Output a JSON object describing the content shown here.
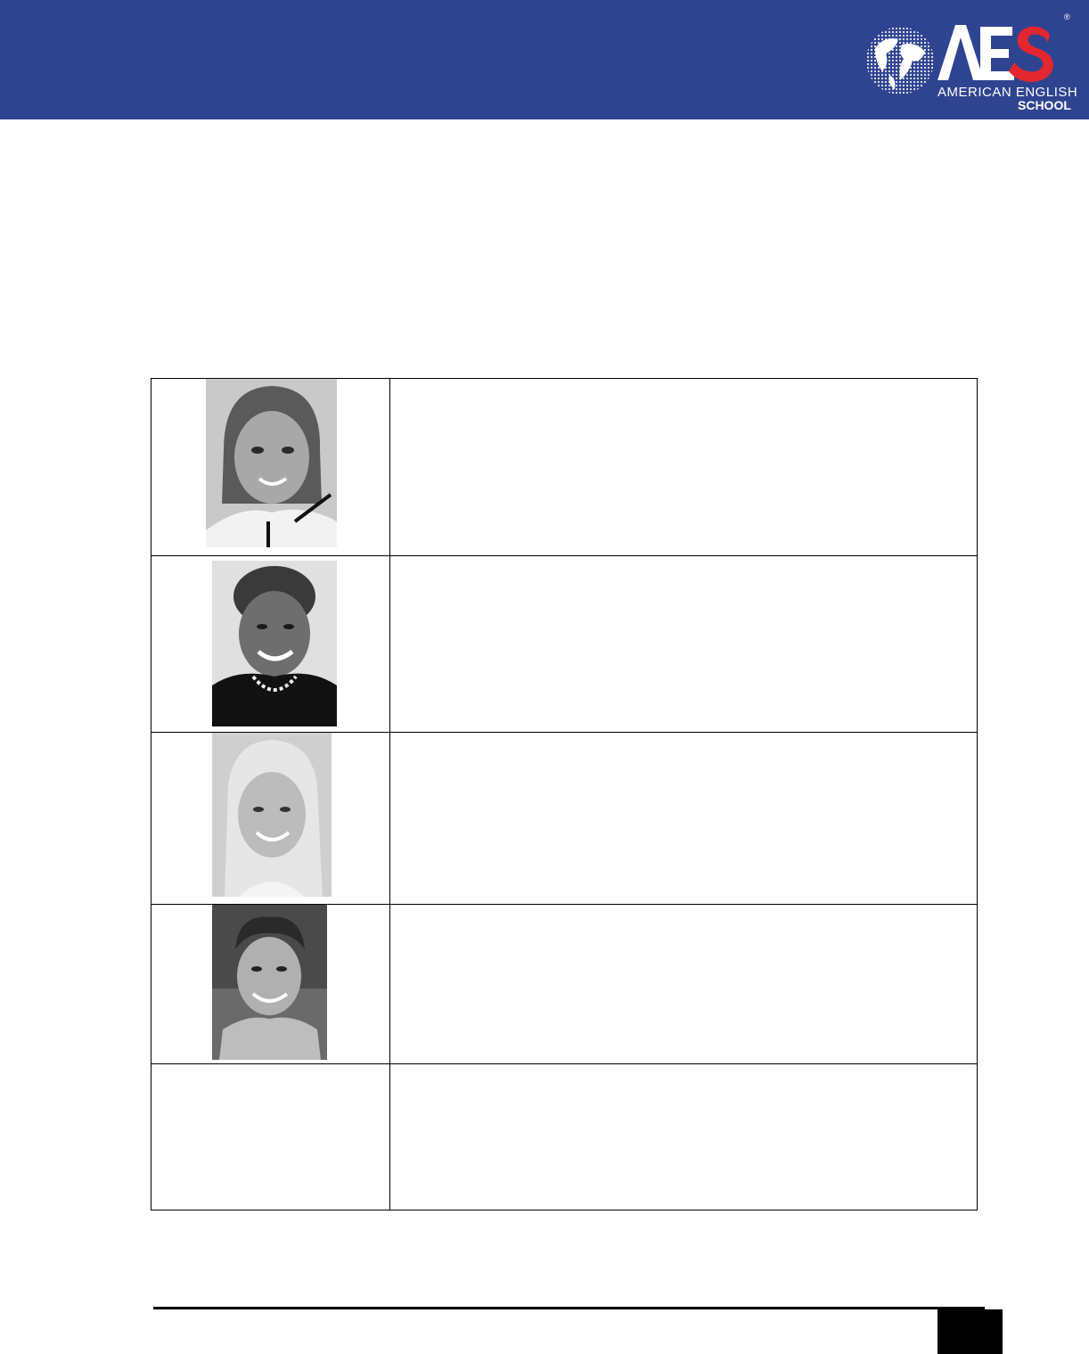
{
  "brand": {
    "logo_letters": "AES",
    "name_line1": "AMERICAN ENGLISH",
    "name_line2": "SCHOOL",
    "registered_mark": "®",
    "header_color": "#2f4491",
    "accent_red": "#e3262f"
  },
  "rows": [
    {
      "photo": "girl-portrait-1",
      "text": ""
    },
    {
      "photo": "boy-portrait-1",
      "text": ""
    },
    {
      "photo": "girl-portrait-2",
      "text": ""
    },
    {
      "photo": "boy-portrait-2",
      "text": ""
    },
    {
      "photo": "",
      "text": ""
    }
  ]
}
